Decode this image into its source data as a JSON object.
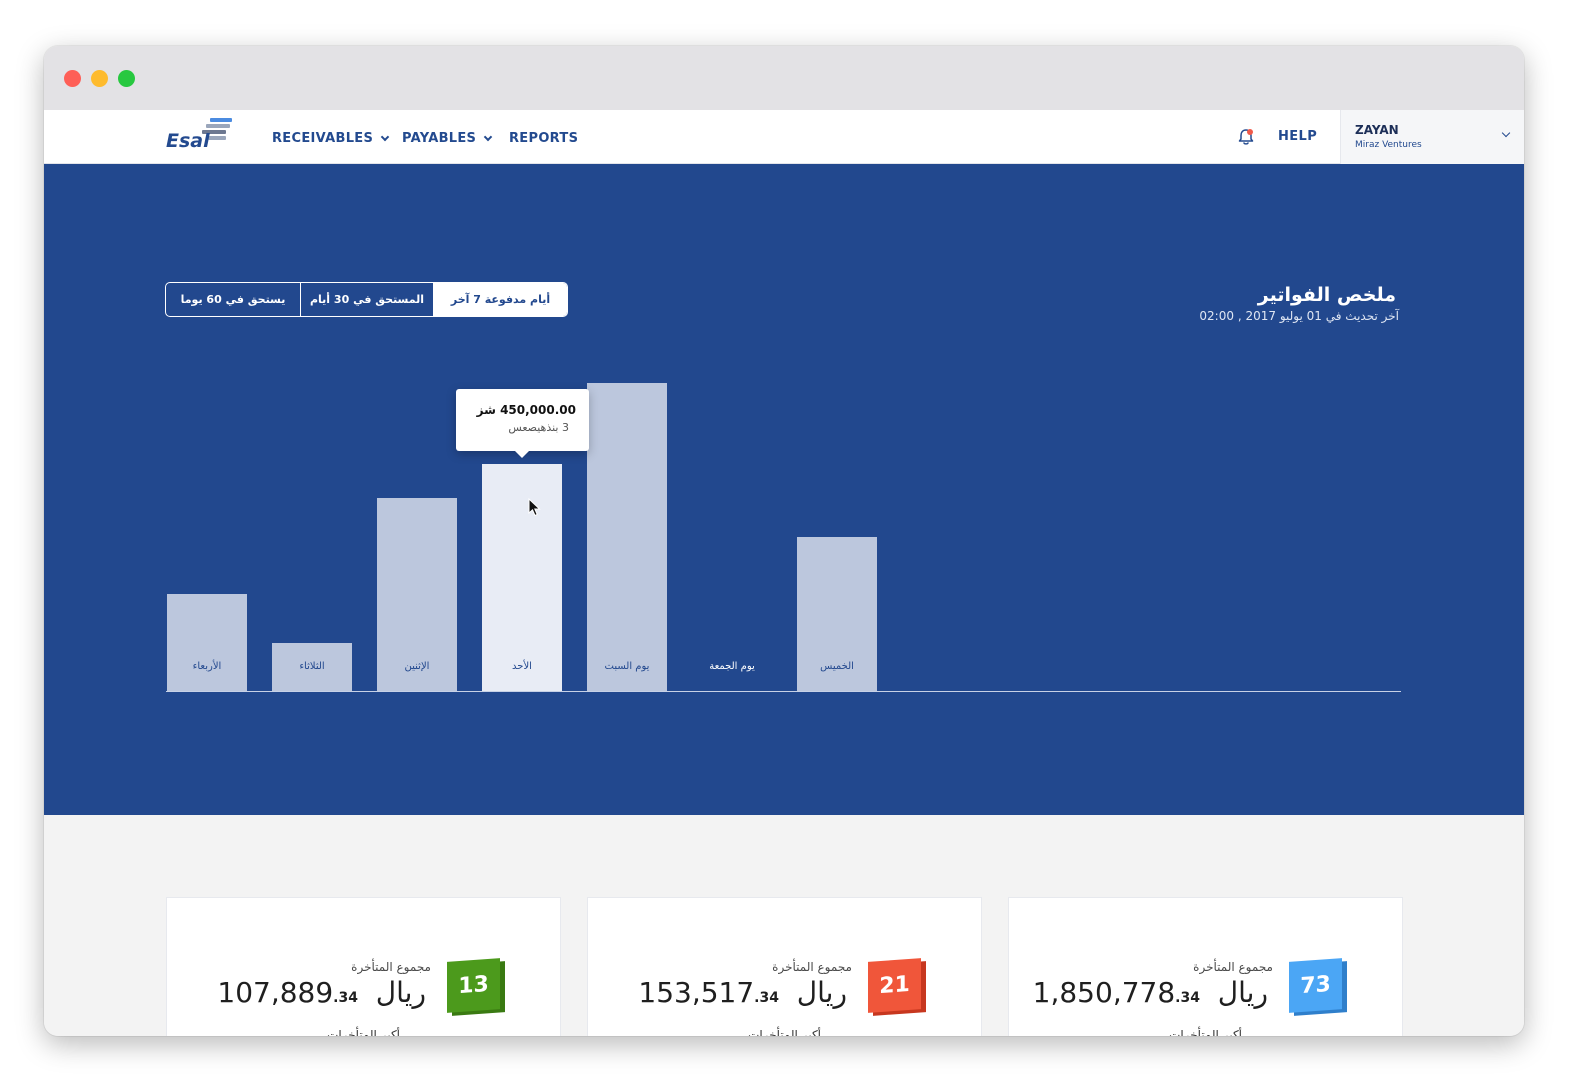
{
  "app": {
    "logo_text": "Esal",
    "nav": [
      {
        "label": "RECEIVABLES"
      },
      {
        "label": "PAYABLES"
      },
      {
        "label": "REPORTS"
      }
    ],
    "help_label": "HELP",
    "user": {
      "name": "ZAYAN",
      "org": "Miraz Ventures"
    },
    "icons": {
      "bell": "bell-icon",
      "notification_dot_color": "#f05a4a"
    },
    "accent": "#22488e"
  },
  "hero": {
    "title": "ملخص الفواتير",
    "subtitle": "آخر تحديث في 01 يوليو 2017 , 02:00",
    "tabs": [
      {
        "label": "يستحق في 60 يوما",
        "active": false
      },
      {
        "label": "المستحق في 30 أيام",
        "active": false
      },
      {
        "label": "أيام مدفوعة 7 آخر",
        "active": true
      }
    ]
  },
  "tooltip": {
    "value": "450,000.00 شز",
    "count": "3 بنذهيصعس"
  },
  "chart_data": {
    "type": "bar",
    "categories": [
      "الأربعاء",
      "الثلاثاء",
      "الإثنين",
      "الأحد",
      "يوم السبت",
      "يوم الجمعة",
      "الخميس"
    ],
    "values": [
      97,
      48,
      193,
      227,
      308,
      0,
      154
    ],
    "active_index": 3
  },
  "cards": [
    {
      "count": "13",
      "color": "#4c9a1c",
      "label": "مجموع المتأخرة",
      "amount": "107,889",
      "cents": ".34",
      "currency": "ريال",
      "footer": "أكبر المتأخرات"
    },
    {
      "count": "21",
      "color": "#f0563a",
      "label": "مجموع المتأخرة",
      "amount": "153,517",
      "cents": ".34",
      "currency": "ريال",
      "footer": "أكبر المتأخرات"
    },
    {
      "count": "73",
      "color": "#4ba6f5",
      "label": "مجموع المتأخرة",
      "amount": "1,850,778",
      "cents": ".34",
      "currency": "ريال",
      "footer": "أكبر المتأخرات"
    }
  ]
}
